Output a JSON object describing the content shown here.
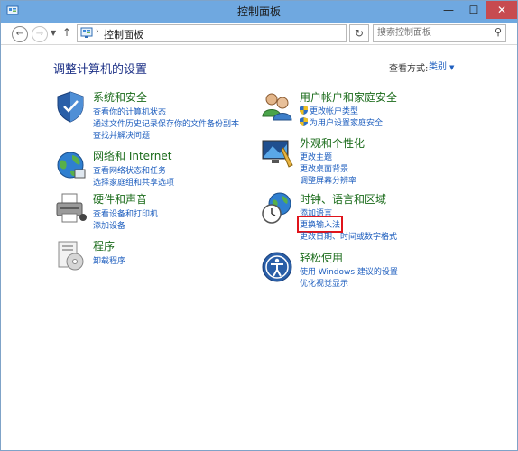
{
  "window": {
    "title": "控制面板",
    "minimize_glyph": "—",
    "maximize_glyph": "☐",
    "close_glyph": "✕"
  },
  "toolbar": {
    "back_glyph": "←",
    "forward_glyph": "→",
    "up_glyph": "↑",
    "path": "控制面板",
    "path_separator": "›",
    "refresh_glyph": "↻",
    "search_placeholder": "搜索控制面板",
    "search_glyph": "⚲"
  },
  "header": {
    "title": "调整计算机的设置",
    "view_label": "查看方式:",
    "view_value": "类别"
  },
  "categories": [
    {
      "name": "系统和安全",
      "icon": "shield-icon",
      "links": [
        "查看你的计算机状态",
        "通过文件历史记录保存你的文件备份副本",
        "查找并解决问题"
      ]
    },
    {
      "name": "网络和 Internet",
      "icon": "network-globe-icon",
      "links": [
        "查看网络状态和任务",
        "选择家庭组和共享选项"
      ]
    },
    {
      "name": "硬件和声音",
      "icon": "printer-icon",
      "links": [
        "查看设备和打印机",
        "添加设备"
      ]
    },
    {
      "name": "程序",
      "icon": "programs-icon",
      "links": [
        "卸载程序"
      ]
    },
    {
      "name": "用户帐户和家庭安全",
      "icon": "users-icon",
      "links": [
        "更改帐户类型",
        "为用户设置家庭安全"
      ]
    },
    {
      "name": "外观和个性化",
      "icon": "appearance-icon",
      "links": [
        "更改主题",
        "更改桌面背景",
        "调整屏幕分辨率"
      ]
    },
    {
      "name": "时钟、语言和区域",
      "icon": "clock-globe-icon",
      "links": [
        "添加语言",
        "更换输入法",
        "更改日期、时间或数字格式"
      ]
    },
    {
      "name": "轻松使用",
      "icon": "ease-of-access-icon",
      "links": [
        "使用 Windows 建议的设置",
        "优化视觉显示"
      ]
    }
  ],
  "colors": {
    "titlebar": "#6fa8e0",
    "category_heading": "#1a6b1a",
    "link": "#1f5fbf",
    "highlight": "#e0141b"
  }
}
